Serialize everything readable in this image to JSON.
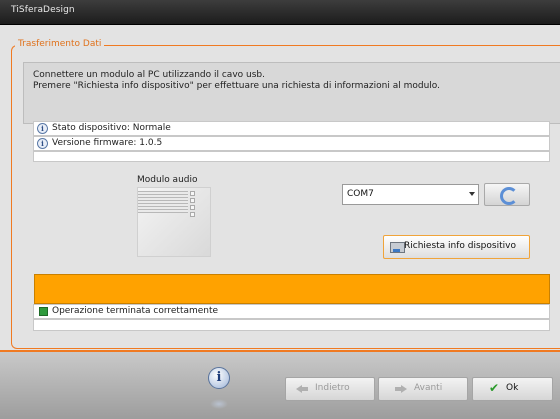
{
  "window": {
    "title": "TiSferaDesign"
  },
  "group": {
    "legend": "Trasferimento Dati"
  },
  "instructions": {
    "line1": "Connettere un modulo al PC utilizzando il cavo usb.",
    "line2": "Premere \"Richiesta info dispositivo\" per effettuare una richiesta di informazioni al modulo."
  },
  "device_info": [
    {
      "icon": "info-icon",
      "text": "Stato dispositivo: Normale"
    },
    {
      "icon": "info-icon",
      "text": "Versione firmware: 1.0.5"
    }
  ],
  "module": {
    "label": "Modulo audio"
  },
  "port": {
    "selected": "COM7"
  },
  "request_button": {
    "label": "Richiesta info dispositivo"
  },
  "progress": {
    "value": 1.0,
    "color": "#ffa200"
  },
  "status": {
    "text": "Operazione terminata correttamente",
    "color": "#2e9a3c"
  },
  "footer": {
    "back_label": "Indietro",
    "next_label": "Avanti",
    "ok_label": "Ok"
  },
  "colors": {
    "accent": "#f07a22",
    "progress": "#ffa200"
  }
}
